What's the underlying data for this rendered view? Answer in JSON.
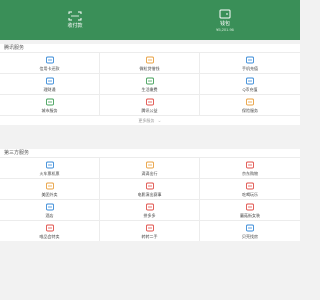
{
  "colors": {
    "brand_green": "#3a8f58",
    "icon_orange": "#e8a040",
    "icon_blue": "#3a8bd8",
    "icon_red": "#e0504a",
    "icon_green": "#43a05a"
  },
  "banner": {
    "left": {
      "label": "收付款",
      "icon": "scan-icon"
    },
    "right": {
      "label": "钱包",
      "sub": "¥5,201.96",
      "icon": "wallet-icon"
    }
  },
  "tencent_services": {
    "title": "腾讯服务",
    "items": [
      {
        "label": "信用卡还款",
        "icon": "credit-card-icon",
        "color": "#3a8bd8"
      },
      {
        "label": "微粒贷借钱",
        "icon": "loan-icon",
        "color": "#e8a040"
      },
      {
        "label": "手机充值",
        "icon": "phone-icon",
        "color": "#3a8bd8"
      },
      {
        "label": "理财通",
        "icon": "wealth-icon",
        "color": "#3a8bd8"
      },
      {
        "label": "生活缴费",
        "icon": "utility-icon",
        "color": "#43a05a"
      },
      {
        "label": "Q币充值",
        "icon": "q-coin-icon",
        "color": "#3a8bd8"
      },
      {
        "label": "城市服务",
        "icon": "city-icon",
        "color": "#43a05a"
      },
      {
        "label": "腾讯公益",
        "icon": "charity-icon",
        "color": "#e0504a"
      },
      {
        "label": "保险服务",
        "icon": "insurance-icon",
        "color": "#e8a040"
      }
    ],
    "more_label": "更多服务"
  },
  "third_party": {
    "title": "第三方服务",
    "items": [
      {
        "label": "火车票机票",
        "icon": "train-icon",
        "color": "#3a8bd8"
      },
      {
        "label": "滴滴出行",
        "icon": "taxi-icon",
        "color": "#e8a040"
      },
      {
        "label": "京东购物",
        "icon": "shopping-icon",
        "color": "#e0504a"
      },
      {
        "label": "美团外卖",
        "icon": "food-icon",
        "color": "#e8a040"
      },
      {
        "label": "电影演出赛事",
        "icon": "movie-icon",
        "color": "#e0504a"
      },
      {
        "label": "吃喝玩乐",
        "icon": "fun-icon",
        "color": "#e0504a"
      },
      {
        "label": "酒店",
        "icon": "hotel-icon",
        "color": "#3a8bd8"
      },
      {
        "label": "拼多多",
        "icon": "pinduoduo-icon",
        "color": "#e0504a"
      },
      {
        "label": "蘑菇街女装",
        "icon": "clothing-icon",
        "color": "#e0504a"
      },
      {
        "label": "唯品会特卖",
        "icon": "vip-sale-icon",
        "color": "#e0504a"
      },
      {
        "label": "转转二手",
        "icon": "second-hand-icon",
        "color": "#e0504a"
      },
      {
        "label": "贝壳找房",
        "icon": "house-icon",
        "color": "#3a8bd8"
      }
    ]
  }
}
